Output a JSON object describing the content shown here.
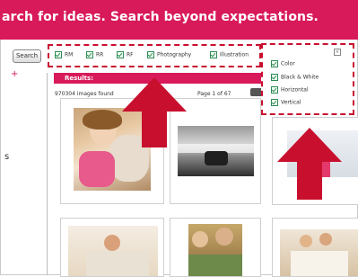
{
  "banner": {
    "text": "arch for ideas. Search beyond expectations."
  },
  "search": {
    "button_label": "Search"
  },
  "filters": [
    {
      "label": "RM",
      "checked": true
    },
    {
      "label": "RR",
      "checked": true
    },
    {
      "label": "RF",
      "checked": true
    },
    {
      "label": "Photography",
      "checked": true
    },
    {
      "label": "Illustration",
      "checked": true
    }
  ],
  "results": {
    "header": "Results:",
    "count_text": "970304 images found",
    "page_text": "Page 1 of 67"
  },
  "sidebar": {
    "plus": "+",
    "letter": "s"
  },
  "color_options": [
    {
      "label": "Color",
      "checked": true
    },
    {
      "label": "Black & White",
      "checked": true
    },
    {
      "label": "Horizontal",
      "checked": true
    },
    {
      "label": "Vertical",
      "checked": true
    }
  ],
  "close_glyph": "×",
  "annotation_color": "#c8102e",
  "brand_color": "#d8195a"
}
